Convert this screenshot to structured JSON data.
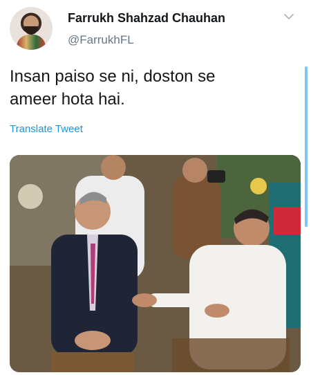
{
  "tweet": {
    "author_name": "Farrukh Shahzad Chauhan",
    "author_handle": "@FarrukhFL",
    "text_line1": "Insan paiso se ni, doston se",
    "text_line2": "ameer hota hai.",
    "translate_label": "Translate Tweet",
    "menu_icon": "chevron-down-icon",
    "accent_color": "#1b95e0"
  }
}
